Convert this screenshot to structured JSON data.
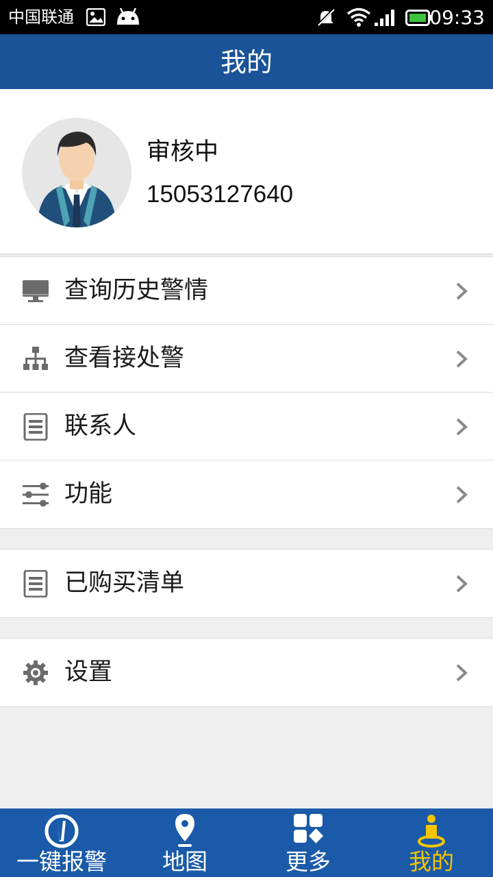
{
  "status_bar": {
    "carrier": "中国联通",
    "time": "09:33"
  },
  "header": {
    "title": "我的"
  },
  "profile": {
    "status": "审核中",
    "phone": "15053127640"
  },
  "menu_groups": [
    {
      "items": [
        {
          "label": "查询历史警情",
          "icon": "monitor-icon"
        },
        {
          "label": "查看接处警",
          "icon": "hierarchy-icon"
        },
        {
          "label": "联系人",
          "icon": "document-icon"
        },
        {
          "label": "功能",
          "icon": "sliders-icon"
        }
      ]
    },
    {
      "items": [
        {
          "label": "已购买清单",
          "icon": "document-icon"
        }
      ]
    },
    {
      "items": [
        {
          "label": "设置",
          "icon": "gear-icon"
        }
      ]
    }
  ],
  "tabbar": {
    "tabs": [
      {
        "label": "一键报警",
        "icon": "alarm-icon",
        "active": false
      },
      {
        "label": "地图",
        "icon": "map-pin-icon",
        "active": false
      },
      {
        "label": "更多",
        "icon": "grid-icon",
        "active": false
      },
      {
        "label": "我的",
        "icon": "person-icon",
        "active": true
      }
    ]
  },
  "colors": {
    "primary": "#1a5398",
    "tabbar": "#1a5aa8",
    "active_tab": "#f6c400",
    "background": "#efefef"
  }
}
